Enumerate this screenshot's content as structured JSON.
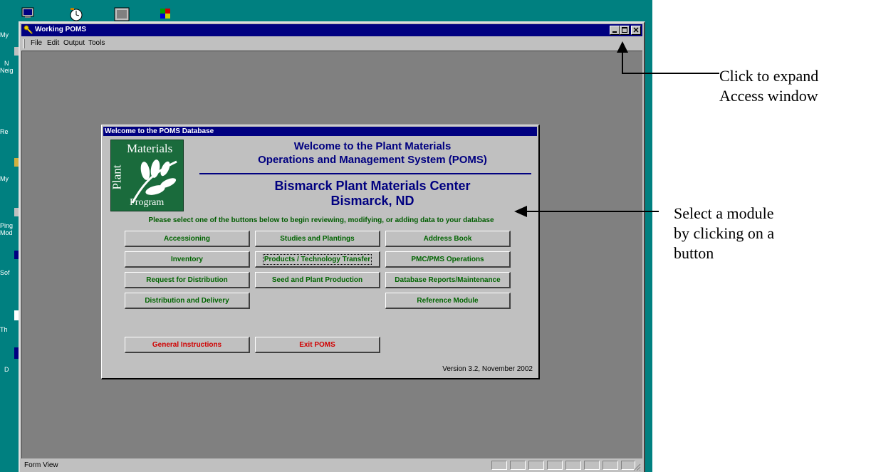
{
  "window": {
    "title": "Working POMS",
    "menu": [
      "File",
      "Edit",
      "Output",
      "Tools"
    ],
    "status_text": "Form View"
  },
  "desktop": {
    "labels": [
      "My",
      "N",
      "Neig",
      "Re",
      "My",
      "Ping",
      "Mod",
      "Sof",
      "Th",
      "D"
    ]
  },
  "form": {
    "title": "Welcome to the POMS Database",
    "logo": {
      "text_top": "Materials",
      "text_side": "Plant",
      "text_bottom": "Program"
    },
    "heading_line1": "Welcome to the Plant Materials",
    "heading_line2": "Operations and Management System (POMS)",
    "center_line1": "Bismarck Plant Materials Center",
    "center_line2": "Bismarck, ND",
    "instructions": "Please select one of the buttons below to begin reviewing, modifying, or adding data to your database",
    "buttons": {
      "accessioning": "Accessioning",
      "inventory": "Inventory",
      "request_distribution": "Request for Distribution",
      "distribution_delivery": "Distribution and Delivery",
      "studies_plantings": "Studies and Plantings",
      "products_tech": "Products / Technology Transfer",
      "seed_plant": "Seed and Plant Production",
      "address_book": "Address Book",
      "pmc_operations": "PMC/PMS Operations",
      "db_reports": "Database Reports/Maintenance",
      "reference_module": "Reference Module",
      "general_instructions": "General Instructions",
      "exit": "Exit POMS"
    },
    "version": "Version 3.2, November 2002"
  },
  "annotations": {
    "expand_line1": "Click to expand",
    "expand_line2": "Access window",
    "select_line1": "Select a module",
    "select_line2": "by clicking on a",
    "select_line3": "button"
  },
  "colors": {
    "desktop": "#008080",
    "titlebar": "#000080",
    "button_text": "#006400",
    "button_text_red": "#d00000",
    "logo_green": "#1a6b3c"
  }
}
